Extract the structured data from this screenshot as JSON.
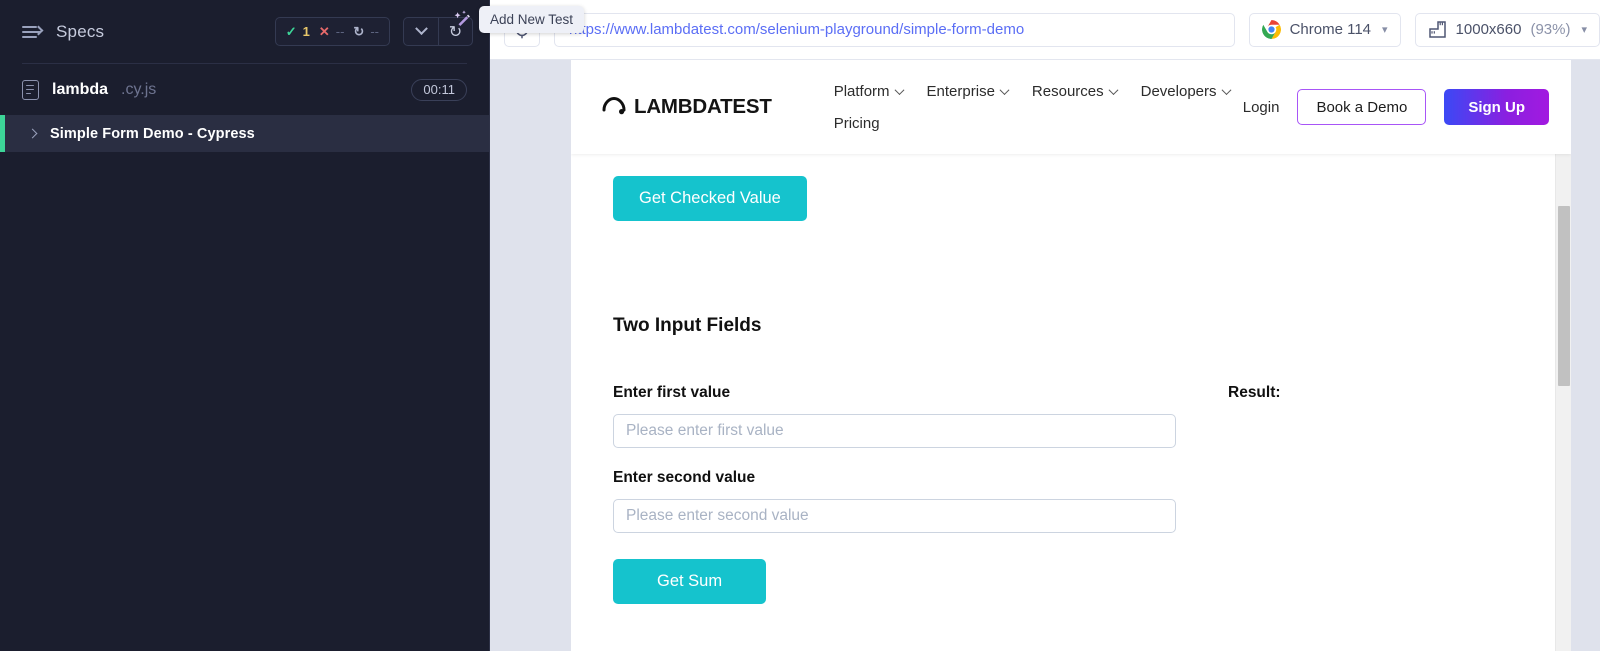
{
  "sidebar": {
    "header": {
      "title": "Specs",
      "menu_icon": "specs-list-icon",
      "stats": {
        "pass_glyph": "✓",
        "pass_count": "1",
        "fail_glyph": "✕",
        "fail_count": "--",
        "pending_glyph": "↻",
        "pending_count": "--"
      },
      "collapse_icon": "chevron-down-icon",
      "reload_icon": "↻"
    },
    "spec_file": {
      "name": "lambda",
      "extension": ".cy.js",
      "duration": "00:11",
      "icon": "file-icon"
    },
    "test": {
      "name": "Simple Form Demo - Cypress",
      "expand_icon": "chevron-right-icon",
      "wand_icon": "magic-wand-icon",
      "tooltip": "Add New Test"
    }
  },
  "browser_bar": {
    "selector_icon": "crosshair-select-icon",
    "url": "https://www.lambdatest.com/selenium-playground/simple-form-demo",
    "browser": {
      "icon": "chrome-icon",
      "label": "Chrome 114",
      "caret": "chevron-down-icon"
    },
    "viewport": {
      "icon": "ruler-icon",
      "size": "1000x660",
      "zoom": "(93%)",
      "caret": "chevron-down-icon"
    }
  },
  "page": {
    "nav": {
      "logo_text": "LAMBDATEST",
      "logo_icon": "lambdatest-arch-logo",
      "menu": [
        {
          "label": "Platform",
          "has_caret": true
        },
        {
          "label": "Enterprise",
          "has_caret": true
        },
        {
          "label": "Resources",
          "has_caret": true
        },
        {
          "label": "Developers",
          "has_caret": true
        },
        {
          "label": "Pricing",
          "has_caret": false
        }
      ],
      "login_label": "Login",
      "demo_label": "Book a Demo",
      "signup_label": "Sign Up"
    },
    "content": {
      "get_checked_value_button": "Get Checked Value",
      "section_title": "Two Input Fields",
      "first_label": "Enter first value",
      "first_placeholder": "Please enter first value",
      "first_value": "",
      "second_label": "Enter second value",
      "second_placeholder": "Please enter second value",
      "second_value": "",
      "get_sum_button": "Get Sum",
      "result_label": "Result:"
    }
  },
  "colors": {
    "sidebar_bg": "#1b1e2e",
    "selected_row_bg": "#2a2e42",
    "pass_green": "#3dd598",
    "fail_red": "#e76a6a",
    "teal_button": "#15c3cd",
    "url_blue": "#5b6ef5",
    "signup_gradient_start": "#3b49f5",
    "signup_gradient_end": "#a21ae0",
    "preview_bg": "#dfe2ec"
  }
}
